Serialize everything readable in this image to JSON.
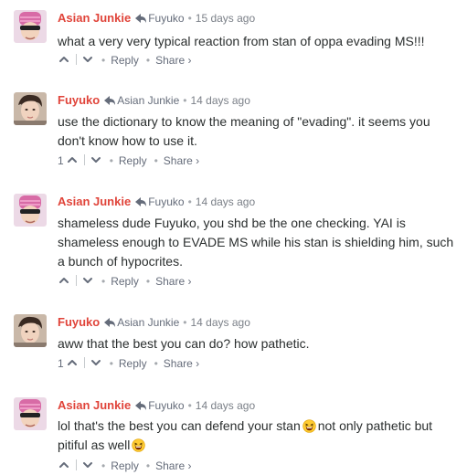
{
  "comments": [
    {
      "author": "Asian Junkie",
      "parent": "Fuyuko",
      "time": "15 days ago",
      "text": "what a very very typical reaction from stan of oppa evading MS!!!",
      "votes": "",
      "reply_label": "Reply",
      "share_label": "Share ›",
      "avatar": "beanie-sunglasses"
    },
    {
      "author": "Fuyuko",
      "parent": "Asian Junkie",
      "time": "14 days ago",
      "text": "use the dictionary to know the meaning of \"evading\". it seems you don't know how to use it.",
      "votes": "1",
      "reply_label": "Reply",
      "share_label": "Share ›",
      "avatar": "young-man"
    },
    {
      "author": "Asian Junkie",
      "parent": "Fuyuko",
      "time": "14 days ago",
      "text": "shameless dude Fuyuko, you shd be the one checking. YAI is shameless enough to EVADE MS while his stan is shielding him, such a bunch of hypocrites.",
      "votes": "",
      "reply_label": "Reply",
      "share_label": "Share ›",
      "avatar": "beanie-sunglasses"
    },
    {
      "author": "Fuyuko",
      "parent": "Asian Junkie",
      "time": "14 days ago",
      "text": "aww that the best you can do? how pathetic.",
      "votes": "1",
      "reply_label": "Reply",
      "share_label": "Share ›",
      "avatar": "young-man"
    },
    {
      "author": "Asian Junkie",
      "parent": "Fuyuko",
      "time": "14 days ago",
      "text_a": "lol that's the best you can defend your stan",
      "text_b": "not only pathetic but pitiful as well",
      "emoji": "laughing-face",
      "votes": "",
      "reply_label": "Reply",
      "share_label": "Share ›",
      "avatar": "beanie-sunglasses"
    }
  ],
  "colors": {
    "author": "#e0443a",
    "meta": "#656c7a",
    "text": "#2a2e2e"
  }
}
